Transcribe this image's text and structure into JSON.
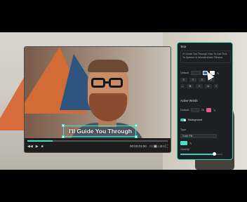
{
  "player": {
    "caption_text": "I'll Guide You Through",
    "progress": 0.18,
    "time_current": "00:00:03:00",
    "time_total": "00:00:10:00"
  },
  "panel": {
    "title": "Text",
    "text_content": "I'll Guide You Through How To Use Text-To-Speech In Wondershare Filmora.",
    "font_label": "Default",
    "active_words_label": "Active Words",
    "active_font_label": "Default",
    "active_size": "26",
    "background_label": "Background",
    "type_label": "Type",
    "type_value": "Color Fill",
    "opacity_label": "Opacity",
    "opacity_value": 0.8,
    "colors": {
      "accent": "#2fd2b6",
      "swatch_blue": "#2d6cdf",
      "swatch_white": "#ffffff",
      "swatch_pink": "#e6588f",
      "bg_fill": "#3ee6c8"
    }
  }
}
